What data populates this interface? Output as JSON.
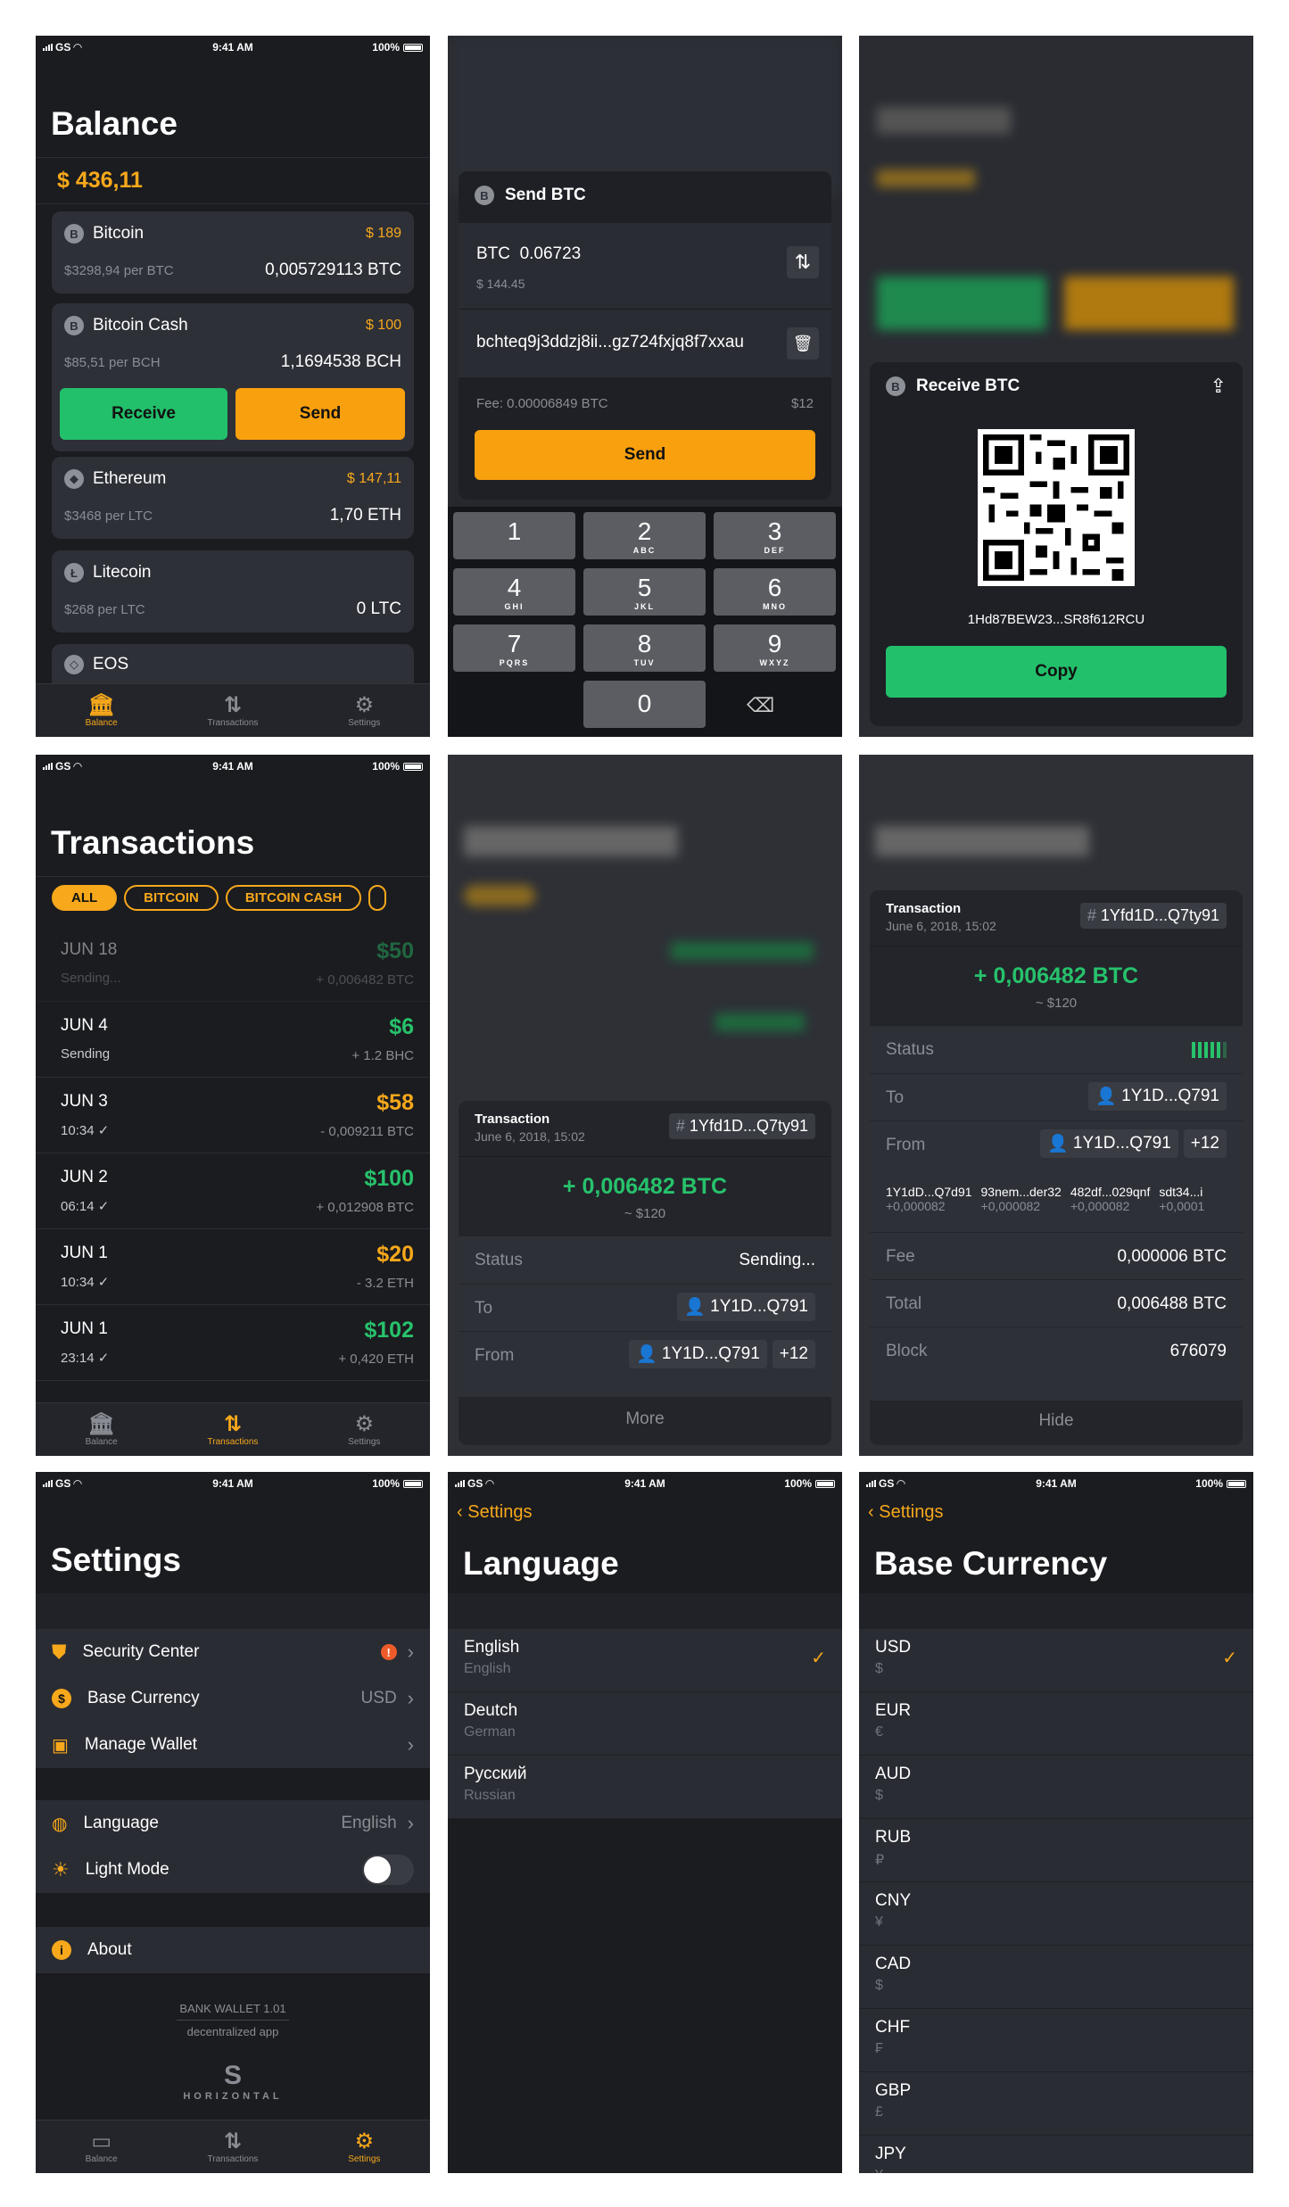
{
  "status": {
    "carrier": "GS",
    "time": "9:41 AM",
    "battery": "100%"
  },
  "tabs": {
    "balance": "Balance",
    "transactions": "Transactions",
    "settings": "Settings"
  },
  "balance": {
    "title": "Balance",
    "total": "$ 436,11",
    "coins": [
      {
        "name": "Bitcoin",
        "usd": "$ 189",
        "price": "$3298,94 per BTC",
        "amount": "0,005729113 BTC",
        "icon": "bitcoin-icon",
        "sym": "B"
      },
      {
        "name": "Bitcoin Cash",
        "usd": "$ 100",
        "price": "$85,51 per BCH",
        "amount": "1,1694538 BCH",
        "icon": "bitcoin-cash-icon",
        "sym": "B"
      },
      {
        "name": "Ethereum",
        "usd": "$ 147,11",
        "price": "$3468 per LTC",
        "amount": "1,70 ETH",
        "icon": "ethereum-icon",
        "sym": "◆"
      },
      {
        "name": "Litecoin",
        "usd": "",
        "price": "$268 per LTC",
        "amount": "0 LTC",
        "icon": "litecoin-icon",
        "sym": "Ł"
      },
      {
        "name": "EOS",
        "usd": "",
        "price": "",
        "amount": "",
        "icon": "eos-icon",
        "sym": "◇"
      }
    ],
    "receive": "Receive",
    "send": "Send"
  },
  "send": {
    "title": "Send BTC",
    "cur": "BTC",
    "amount": "0.06723",
    "usd": "$ 144.45",
    "address": "bchteq9j3ddzj8ii...gz724fxjq8f7xxau",
    "fee": "Fee: 0.00006849 BTC",
    "fee_usd": "$12",
    "button": "Send",
    "keys": [
      {
        "n": "1",
        "s": ""
      },
      {
        "n": "2",
        "s": "ABC"
      },
      {
        "n": "3",
        "s": "DEF"
      },
      {
        "n": "4",
        "s": "GHI"
      },
      {
        "n": "5",
        "s": "JKL"
      },
      {
        "n": "6",
        "s": "MNO"
      },
      {
        "n": "7",
        "s": "PQRS"
      },
      {
        "n": "8",
        "s": "TUV"
      },
      {
        "n": "9",
        "s": "WXYZ"
      }
    ],
    "zero": "0"
  },
  "receive": {
    "title": "Receive BTC",
    "address": "1Hd87BEW23...SR8f612RCU",
    "copy": "Copy"
  },
  "transactions": {
    "title": "Transactions",
    "filters": [
      "ALL",
      "BITCOIN",
      "BITCOIN CASH"
    ],
    "rows": [
      {
        "date": "JUN 18",
        "sub": "Sending...",
        "usd": "$50",
        "amount": "+ 0,006482 BTC",
        "color": "green",
        "faded": true
      },
      {
        "date": "JUN 4",
        "sub": "Sending",
        "usd": "$6",
        "amount": "+ 1.2 BHC",
        "color": "green",
        "faded": false
      },
      {
        "date": "JUN 3",
        "sub": "10:34 ✓",
        "usd": "$58",
        "amount": "- 0,009211 BTC",
        "color": "orange",
        "faded": false
      },
      {
        "date": "JUN 2",
        "sub": "06:14 ✓",
        "usd": "$100",
        "amount": "+ 0,012908 BTC",
        "color": "green",
        "faded": false
      },
      {
        "date": "JUN 1",
        "sub": "10:34 ✓",
        "usd": "$20",
        "amount": "- 3.2 ETH",
        "color": "orange",
        "faded": false
      },
      {
        "date": "JUN 1",
        "sub": "23:14 ✓",
        "usd": "$102",
        "amount": "+ 0,420 ETH",
        "color": "green",
        "faded": false
      }
    ]
  },
  "tx": {
    "label": "Transaction",
    "date": "June 6, 2018, 15:02",
    "hash": "1Yfd1D...Q7ty91",
    "amount": "+ 0,006482 BTC",
    "usd": "~ $120",
    "status": "Status",
    "sending": "Sending...",
    "to": "To",
    "to_addr": "1Y1D...Q791",
    "from": "From",
    "from_addr": "1Y1D...Q791",
    "plus": "+12",
    "more": "More",
    "outputs": [
      {
        "a": "1Y1dD...Q7d91",
        "b": "+0,000082"
      },
      {
        "a": "93nem...der32",
        "b": "+0,000082"
      },
      {
        "a": "482df...029qnf",
        "b": "+0,000082"
      },
      {
        "a": "sdt34...i",
        "b": "+0,0001"
      }
    ],
    "fee": "Fee",
    "fee_v": "0,000006 BTC",
    "total": "Total",
    "total_v": "0,006488 BTC",
    "block": "Block",
    "block_v": "676079",
    "hide": "Hide"
  },
  "settings": {
    "title": "Settings",
    "security": "Security Center",
    "base": "Base Currency",
    "base_v": "USD",
    "wallet": "Manage Wallet",
    "language": "Language",
    "language_v": "English",
    "light": "Light Mode",
    "about": "About",
    "app": "BANK WALLET 1.01",
    "tagline": "decentralized app",
    "logo_text": "HORIZONTAL"
  },
  "language": {
    "back": "Settings",
    "title": "Language",
    "items": [
      {
        "a": "English",
        "b": "English"
      },
      {
        "a": "Deutch",
        "b": "German"
      },
      {
        "a": "Русский",
        "b": "Russian"
      }
    ]
  },
  "currency": {
    "back": "Settings",
    "title": "Base Currency",
    "items": [
      {
        "a": "USD",
        "b": "$"
      },
      {
        "a": "EUR",
        "b": "€"
      },
      {
        "a": "AUD",
        "b": "$"
      },
      {
        "a": "RUB",
        "b": "₽"
      },
      {
        "a": "CNY",
        "b": "¥"
      },
      {
        "a": "CAD",
        "b": "$"
      },
      {
        "a": "CHF",
        "b": "₣"
      },
      {
        "a": "GBP",
        "b": "£"
      },
      {
        "a": "JPY",
        "b": "¥"
      }
    ]
  },
  "colors": {
    "accent": "#f7a81b",
    "green": "#22c06b",
    "bg": "#1b1c20",
    "card": "#2e3038"
  }
}
